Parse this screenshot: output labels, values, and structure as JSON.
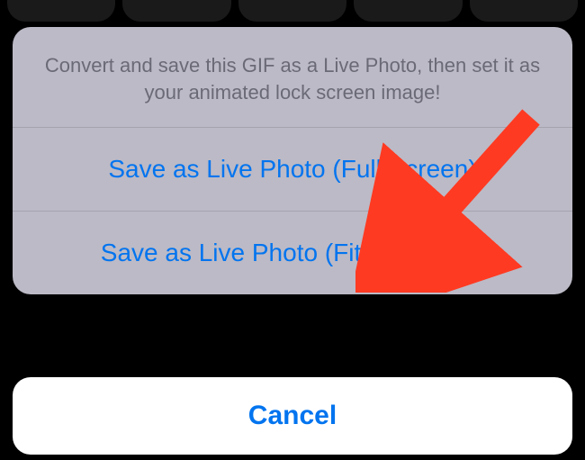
{
  "action_sheet": {
    "header_text": "Convert and save this GIF as a Live Photo, then set it as your animated lock screen image!",
    "options": [
      {
        "label": "Save as Live Photo (Full Screen)"
      },
      {
        "label": "Save as Live Photo (Fit to Screen)"
      }
    ],
    "cancel_label": "Cancel"
  },
  "annotation": {
    "type": "arrow",
    "color": "#ff3a22"
  }
}
